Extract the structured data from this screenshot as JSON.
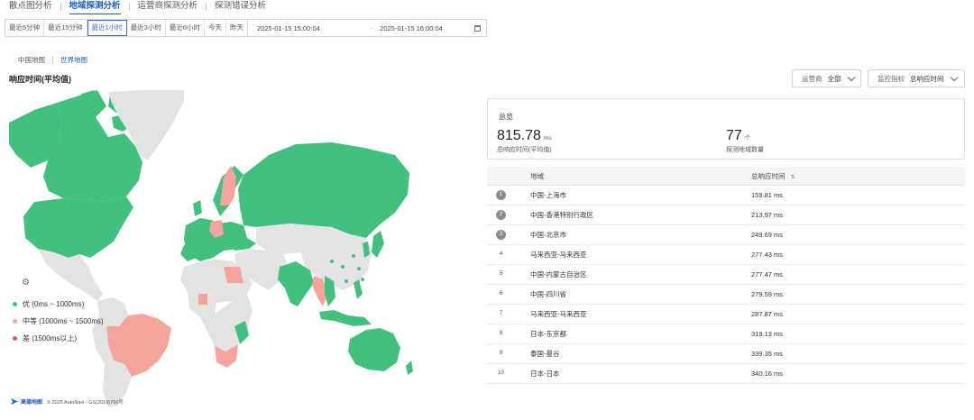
{
  "nav": {
    "items": [
      {
        "label": "散点图分析",
        "active": false
      },
      {
        "label": "地域探测分析",
        "active": true
      },
      {
        "label": "运营商探测分析",
        "active": false
      },
      {
        "label": "探测错误分析",
        "active": false
      }
    ]
  },
  "timebar": {
    "buttons": [
      "最近5分钟",
      "最近15分钟",
      "最近1小时",
      "最近3小时",
      "最近6小时",
      "今天",
      "昨天"
    ],
    "active_index": 2,
    "start": "2025-01-15 15:00:04",
    "separator": "-",
    "end": "2025-01-15 16:00:04"
  },
  "map_tabs": [
    {
      "label": "中国地图",
      "active": false
    },
    {
      "label": "世界地图",
      "active": true
    }
  ],
  "section_title": "响应时间(平均值)",
  "filters": {
    "operator_label": "运营商",
    "operator_value": "全部",
    "metric_label": "监控指标",
    "metric_value": "总响应时间"
  },
  "legend": {
    "items": [
      {
        "label": "优 (0ms ~ 1000ms)",
        "color": "#41c07e"
      },
      {
        "label": "中等 (1000ms ~ 1500ms)",
        "color": "#f5a49b"
      },
      {
        "label": "差 (1500ms以上)",
        "color": "#e8555a"
      }
    ]
  },
  "map_footer": {
    "brand": "高德地图",
    "copyright": "© 2025 AutoNavi - GS(2019)756号"
  },
  "overview": {
    "title": "总览",
    "avg": {
      "value": "815.78",
      "unit": "ms",
      "desc": "总响应时间(平均值)"
    },
    "regions": {
      "value": "77",
      "unit": "个",
      "desc": "探测地域数量"
    }
  },
  "table": {
    "col_region": "地域",
    "col_value": "总响应时间",
    "rows": [
      {
        "rank": "1",
        "region": "中国-上海市",
        "value": "159.81 ms"
      },
      {
        "rank": "2",
        "region": "中国-香港特别行政区",
        "value": "213.97 ms"
      },
      {
        "rank": "3",
        "region": "中国-北京市",
        "value": "249.69 ms"
      },
      {
        "rank": "4",
        "region": "马来西亚-马来西亚",
        "value": "277.43 ms"
      },
      {
        "rank": "5",
        "region": "中国-内蒙古自治区",
        "value": "277.47 ms"
      },
      {
        "rank": "6",
        "region": "中国-四川省",
        "value": "279.59 ms"
      },
      {
        "rank": "7",
        "region": "马来西亚-马来西亚",
        "value": "287.87 ms"
      },
      {
        "rank": "8",
        "region": "日本-东京都",
        "value": "319.13 ms"
      },
      {
        "rank": "9",
        "region": "泰国-曼谷",
        "value": "339.35 ms"
      },
      {
        "rank": "10",
        "region": "日本-日本",
        "value": "340.16 ms"
      }
    ]
  },
  "colors": {
    "good": "#41c07e",
    "medium": "#f5a49b",
    "land": "#e3e3e3",
    "accent": "#1a5fb4"
  }
}
